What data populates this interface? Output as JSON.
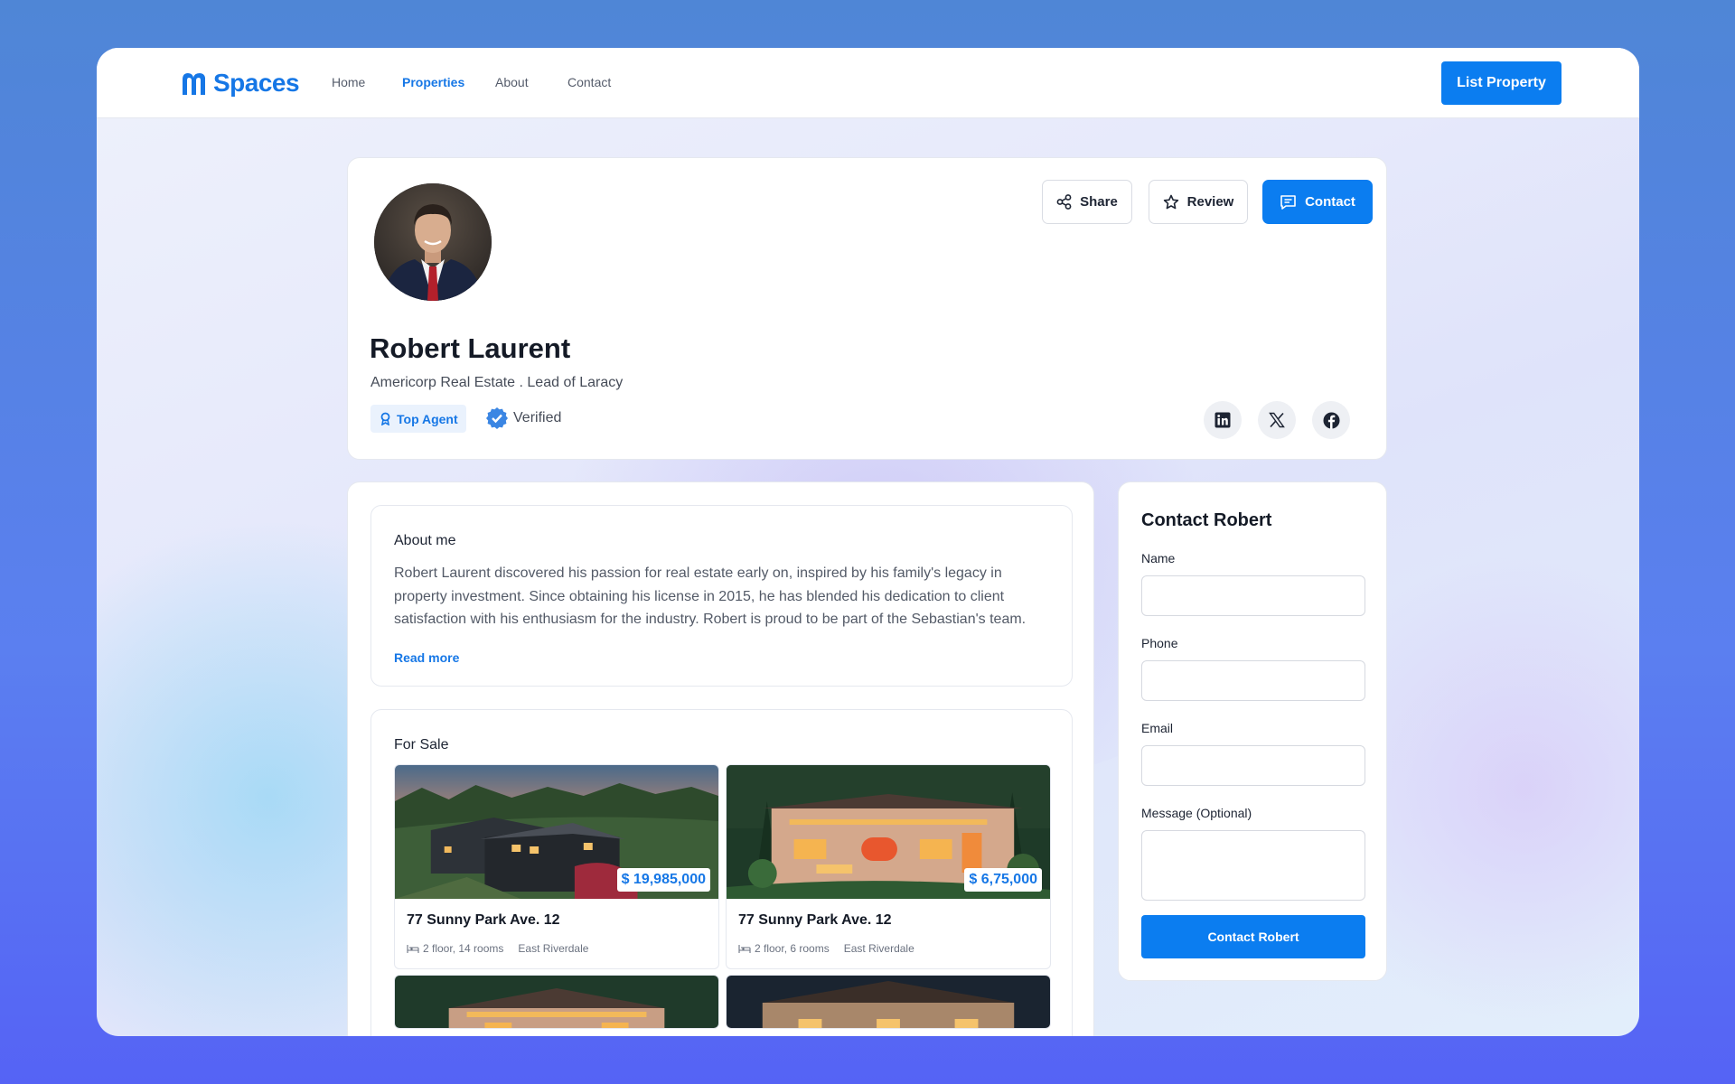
{
  "nav": {
    "logo": "Spaces",
    "links": [
      "Home",
      "Properties",
      "About",
      "Contact"
    ],
    "cta": "List Property"
  },
  "profile": {
    "name": "Robert Laurent",
    "company": "Americorp Real Estate .  Lead of Laracy",
    "badge": "Top Agent",
    "verified": "Verified",
    "actions": {
      "share": "Share",
      "review": "Review",
      "contact": "Contact"
    },
    "social": [
      "linkedin-icon",
      "x-icon",
      "facebook-icon"
    ]
  },
  "about": {
    "heading": "About me",
    "text": "Robert Laurent discovered his passion for real estate early on, inspired by his family's legacy in property investment. Since obtaining his license in 2015, he has blended his dedication to client satisfaction with his enthusiasm for the industry. Robert is proud to be part of the Sebastian's team.",
    "read_more": "Read more"
  },
  "for_sale": {
    "heading": "For Sale",
    "properties": [
      {
        "price": "$ 19,985,000",
        "title": "77 Sunny Park Ave. 12",
        "rooms": "2 floor, 14 rooms",
        "location": "East Riverdale"
      },
      {
        "price": "$ 6,75,000",
        "title": "77 Sunny Park Ave. 12",
        "rooms": "2 floor, 6 rooms",
        "location": "East Riverdale"
      }
    ]
  },
  "contact_form": {
    "heading": "Contact Robert",
    "name_label": "Name",
    "phone_label": "Phone",
    "email_label": "Email",
    "message_label": "Message (Optional)",
    "submit": "Contact Robert"
  },
  "colors": {
    "accent": "#0b7df0",
    "brand": "#1677e6",
    "window_bg": "#eef1fb"
  }
}
